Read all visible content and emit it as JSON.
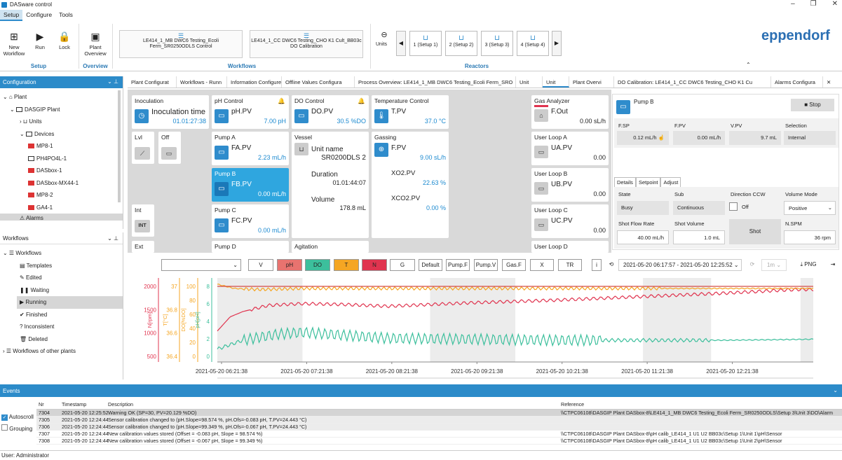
{
  "app": {
    "title": "DASware control"
  },
  "window_controls": {
    "minimize": "–",
    "maximize": "❐",
    "close": "✕"
  },
  "menu": [
    "Setup",
    "Configure",
    "Tools"
  ],
  "ribbon": {
    "buttons": [
      {
        "label": "New Workflow"
      },
      {
        "label": "Run"
      },
      {
        "label": "Lock"
      },
      {
        "label": "Plant Overview"
      }
    ],
    "groups": {
      "setup": "Setup",
      "overview": "Overview",
      "workflows": "Workflows",
      "reactors": "Reactors"
    },
    "workflows": [
      "LE414_1_MB DWC6 Testing_Ecoli Ferm_SR0250ODLS Control",
      "LE414_1_CC DWC6 Testing_CHO K1 Cult_BB03c DO Calibration"
    ],
    "units_label": "Units",
    "reactors": [
      "1 (Setup 1)",
      "2 (Setup 2)",
      "3 (Setup 3)",
      "4 (Setup 4)"
    ],
    "logo": "eppendorf"
  },
  "config": {
    "title": "Configuration",
    "tree": [
      "Plant",
      "DASGIP Plant",
      "Units",
      "Devices",
      "MP8-1",
      "PH4PO4L-1",
      "DASbox-1",
      "DASbox-MX44-1",
      "MP8-2",
      "GA4-1",
      "Alarms"
    ]
  },
  "workflows_panel": {
    "title": "Workflows",
    "tree": [
      "Workflows",
      "Templates",
      "Edited",
      "Waiting",
      "Running",
      "Finished",
      "Inconsistent",
      "Deleted",
      "Workflows of other plants"
    ]
  },
  "tabs": [
    "Plant Configurat",
    "Workflows - Runn",
    "Information Configure",
    "Offline Values Configura",
    "Process Overview: LE414_1_MB DWC6 Testing_Ecoli Ferm_SRO",
    "Unit",
    "Unit",
    "Plant Overvi",
    "DO Calibration: LE414_1_CC DWC6 Testing_CHO K1 Cu",
    "Alarms Configura"
  ],
  "cards": {
    "inoculation": {
      "title": "Inoculation",
      "label": "Inoculation time",
      "value": "01.01:27:38"
    },
    "ph": {
      "title": "pH Control",
      "label": "pH.PV",
      "value": "7.00 pH"
    },
    "do": {
      "title": "DO Control",
      "label": "DO.PV",
      "value": "30.5 %DO"
    },
    "temp": {
      "title": "Temperature Control",
      "label": "T.PV",
      "value": "37.0 °C"
    },
    "gas_an": {
      "title": "Gas Analyzer",
      "label": "F.Out",
      "value": "0.00 sL/h"
    },
    "lvl": {
      "title": "Lvl"
    },
    "off": {
      "title": "Off"
    },
    "pumpA": {
      "title": "Pump A",
      "label": "FA.PV",
      "value": "2.23 mL/h"
    },
    "vessel": {
      "title": "Vessel",
      "unit_label": "Unit name",
      "unit_value": "SR0200DLS 2",
      "dur_label": "Duration",
      "dur_value": "01.01:44:07",
      "vol_label": "Volume",
      "vol_value": "178.8 mL"
    },
    "gassing": {
      "title": "Gassing",
      "label": "F.PV",
      "value": "9.00 sL/h",
      "xo2_label": "XO2.PV",
      "xo2_value": "22.63 %",
      "xco2_label": "XCO2.PV",
      "xco2_value": "0.00 %"
    },
    "loopA": {
      "title": "User Loop A",
      "label": "UA.PV",
      "value": "0.00"
    },
    "pumpB": {
      "title": "Pump B",
      "label": "FB.PV",
      "value": "0.00 mL/h"
    },
    "loopB": {
      "title": "User Loop B",
      "label": "UB.PV",
      "value": "0.00"
    },
    "int": {
      "title": "Int",
      "badge": "INT"
    },
    "pumpC": {
      "title": "Pump C",
      "label": "FC.PV",
      "value": "0.00 mL/h"
    },
    "loopC": {
      "title": "User Loop C",
      "label": "UC.PV",
      "value": "0.00"
    },
    "ext": {
      "title": "Ext"
    },
    "pumpD": {
      "title": "Pump D"
    },
    "agitation": {
      "title": "Agitation"
    },
    "loopD": {
      "title": "User Loop D"
    }
  },
  "detail": {
    "title": "Pump B",
    "stop": "Stop",
    "fsp_label": "F.SP",
    "fsp": "0.12 mL/h",
    "fpv_label": "F.PV",
    "fpv": "0.00 mL/h",
    "vpv_label": "V.PV",
    "vpv": "9.7 mL",
    "sel_label": "Selection",
    "sel": "Internal",
    "tabs": [
      "Details",
      "Setpoint",
      "Adjust"
    ],
    "state_label": "State",
    "state": "Busy",
    "sub_label": "Sub",
    "sub": "Continuous",
    "dir_label": "Direction CCW",
    "dir": "Off",
    "vm_label": "Volume Mode",
    "vm": "Positive",
    "sfr_label": "Shot Flow Rate",
    "sfr": "40.00 mL/h",
    "sv_label": "Shot Volume",
    "sv": "1.0 mL",
    "shot": "Shot",
    "nspm_label": "N.SPM",
    "nspm": "36 rpm"
  },
  "trend_toolbar": {
    "buttons": [
      "V",
      "pH",
      "DO",
      "T",
      "N",
      "G",
      "Default",
      "Pump.F",
      "Pump.V",
      "Gas.F",
      "X",
      "TR"
    ],
    "range": "2021-05-20 06:17:57 - 2021-05-20 12:25:52",
    "interval": "1m",
    "png": "PNG",
    "colors": {
      "pH": "#e8736f",
      "DO": "#3cbf9c",
      "T": "#f5a623",
      "N": "#e0344f"
    }
  },
  "chart_data": {
    "type": "line",
    "x_ticks": [
      "2021-05-20 06:21:38",
      "2021-05-20 07:21:38",
      "2021-05-20 08:21:38",
      "2021-05-20 09:21:38",
      "2021-05-20 10:21:38",
      "2021-05-20 11:21:38",
      "2021-05-20 12:21:38"
    ],
    "axes": [
      {
        "label": "N[rpm]",
        "ticks": [
          "2000",
          "1500",
          "1000",
          "500"
        ],
        "color": "#e0344f"
      },
      {
        "label": "T[°C]",
        "ticks": [
          "37",
          "36.8",
          "36.6",
          "36.4"
        ],
        "color": "#f5a623"
      },
      {
        "label": "DO[%DO]",
        "ticks": [
          "100",
          "80",
          "60",
          "40",
          "20",
          "0"
        ],
        "color": "#f5a623"
      },
      {
        "label": "pH[pH]",
        "ticks": [
          "8",
          "6",
          "4",
          "2",
          "0"
        ],
        "color": "#3cbf9c"
      }
    ],
    "series": [
      {
        "color": "#e0344f",
        "x_hours": [
          0,
          0.15,
          0.3,
          0.6,
          1,
          1.5,
          2,
          3,
          4,
          5,
          6,
          6.8,
          7
        ],
        "y": [
          1000,
          1320,
          1440,
          1580,
          1620,
          1600,
          1560,
          1640,
          1700,
          1780,
          1860,
          1940,
          1940
        ]
      },
      {
        "color": "#f5a623",
        "x_hours": [
          0,
          0.2,
          0.5,
          1,
          2,
          3,
          4,
          5,
          6,
          7
        ],
        "y": [
          37.04,
          37.0,
          36.99,
          37.0,
          37.0,
          37.0,
          37.0,
          37.0,
          37.0,
          37.0
        ]
      },
      {
        "color": "#d44a46",
        "x_hours": [
          0,
          6.8,
          7
        ],
        "y": [
          2010,
          2010,
          2010
        ]
      },
      {
        "color": "#3cbf9c",
        "x_hours": [
          0,
          0.3,
          0.7,
          1,
          2,
          3,
          4,
          5,
          6,
          7
        ],
        "y": [
          1.3,
          2.2,
          2.8,
          3.0,
          2.4,
          2.3,
          2.2,
          2.2,
          2.2,
          2.3
        ]
      }
    ]
  },
  "events": {
    "title": "Events",
    "autoscroll": "Autoscroll",
    "grouping": "Grouping",
    "columns": [
      "Nr",
      "Timestamp",
      "Description",
      "Reference"
    ],
    "rows": [
      [
        "7304",
        "2021-05-20 12:25:52",
        "Warning OK (SP=30, PV=20.129 %DO)",
        "\\\\CTPC06108\\DASGIP Plant DASbox-8\\LE414_1_MB DWC6 Testing_Ecoli Ferm_SR0250ODLS\\Setup 3\\Unit 3\\DO\\Alarm"
      ],
      [
        "7305",
        "2021-05-20 12:24:44",
        "Sensor calibration changed to (pH.Slope=98.574 %, pH.Ofs=-0.083 pH, T.PV=24.443 °C)",
        ""
      ],
      [
        "7306",
        "2021-05-20 12:24:44",
        "Sensor calibration changed to (pH.Slope=99.349 %, pH.Ofs=-0.067 pH, T.PV=24.443 °C)",
        ""
      ],
      [
        "7307",
        "2021-05-20 12:24:44",
        "New calibration values stored (Offset = -0.083 pH, Slope = 98.574 %)",
        "\\\\CTPC06108\\DASGIP Plant DASbox-8\\pH calib_LE414_1 U1 U2 BB03c\\Setup 1\\Unit 1\\pH\\Sensor"
      ],
      [
        "7308",
        "2021-05-20 12:24:44",
        "New calibration values stored (Offset = -0.067 pH, Slope = 99.349 %)",
        "\\\\CTPC06108\\DASGIP Plant DASbox-8\\pH calib_LE414_1 U1 U2 BB03c\\Setup 1\\Unit 2\\pH\\Sensor"
      ]
    ]
  },
  "status": {
    "user": "User: Administrator"
  }
}
